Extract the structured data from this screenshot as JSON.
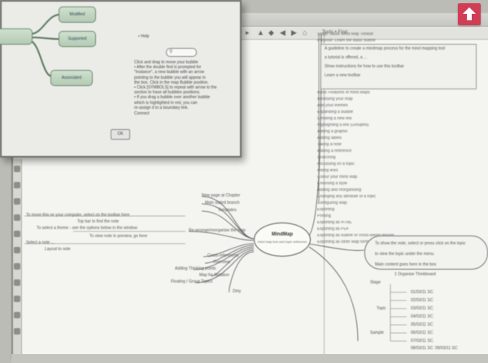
{
  "dialog": {
    "help_link": "• Help",
    "text_lines": [
      "Click and drag to move your bubble",
      "• After the double find is prompted for",
      "  \"Instance\", a new bubble with an arrow",
      "  pointing to the bubble you will appear in",
      "  the box. Click in the map Bubble position.",
      "• Click [SYMBOLS] to repeat with arrow to the",
      "  section to have all bubbles positions.",
      "• If you drag a bubble over another bubble",
      "  which is highlighted in red, you can",
      "  re-assign it to a boundary link."
    ],
    "sub_label": "Connect",
    "ok_label": "OK",
    "mini_nodes": [
      "Modified",
      "Supported",
      "Associated"
    ]
  },
  "toolbar": {
    "label": "Tools • Find"
  },
  "outline": {
    "items": [
      "Stage: Basic Mind Map Toolbar",
      "Purpose: Learn the basic outline",
      "Basic Features of mind Maps",
      "Modifying your map",
      "Add your themes",
      "Expanding a bubble",
      "Creating a new link",
      "Highlighting a link (Grouped)",
      "Adding a graphic",
      "Adding labels",
      "Taking a note",
      "Adding a reference",
      "Searching",
      "Focussing on a topic",
      "Hiding links",
      "Colour your mind Map",
      "Choosing a style",
      "Adding and reorganising",
      "Changing any attribute of a topic",
      "Configuring Map",
      "Exporting",
      "Printing",
      "Exporting as HTML",
      "Exporting as PDF",
      "Exporting as outline or cross-linked groups",
      "Exporting as other Map formats"
    ],
    "box_text": [
      "A guideline to create a mindmap process for the mind mapping tool",
      "a tutorial is offered, a ...",
      "Show instructions for how to use this toolbar",
      "Learn a new toolbar"
    ]
  },
  "map": {
    "center_title": "MindMap",
    "center_sub": "mind map tool and topic reference",
    "left_branches": [
      "New page at Chapter",
      "Main stated branch",
      "Templates",
      "Re-arrange/reorganise the map",
      "Cross-references",
      "Overview",
      "Adding Thinking points",
      "Map for Notation",
      "Floating / Group Topics",
      "Dirty"
    ],
    "far_left": [
      "To move this on your computer, select on the toolbar here",
      "Top bar to find the note",
      "To select a theme - see the options below in the window",
      "To view note in preview, go here",
      "Select a note ...",
      "Layout to note"
    ],
    "bubble_text": [
      "To show the note, select or press click on the topic",
      "to view the topic under the menu",
      "Main content goes here in the box"
    ],
    "detail_title": "1 Organise Thinkboard",
    "detail_items": [
      "01/03/11 SC",
      "02/03/11 SC",
      "03/03/11 SC",
      "04/03/11 SC",
      "05/03/11 SC",
      "06/03/11 SC",
      "07/03/11 SC",
      "08/03/11 SC",
      "09/03/11 SC"
    ],
    "detail_labels": [
      "Stage",
      "Topic",
      "Sample"
    ]
  },
  "colors": {
    "upload": "#d13d55",
    "node_green": "#b4cbb4"
  }
}
